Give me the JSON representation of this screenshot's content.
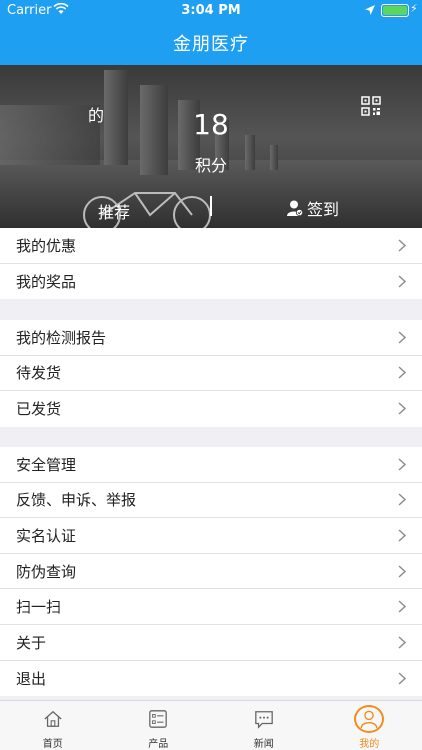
{
  "status": {
    "carrier": "Carrier",
    "time": "3:04 PM"
  },
  "nav": {
    "title": "金朋医疗"
  },
  "profile": {
    "nickname": "的",
    "points": "18",
    "points_label": "积分",
    "recommend_label": "推荐",
    "checkin_label": "签到"
  },
  "groups": [
    {
      "items": [
        {
          "label": "我的优惠"
        },
        {
          "label": "我的奖品"
        }
      ]
    },
    {
      "items": [
        {
          "label": "我的检测报告"
        },
        {
          "label": "待发货"
        },
        {
          "label": "已发货"
        }
      ]
    },
    {
      "items": [
        {
          "label": "安全管理"
        },
        {
          "label": "反馈、申诉、举报"
        },
        {
          "label": "实名认证"
        },
        {
          "label": "防伪查询"
        },
        {
          "label": "扫一扫"
        },
        {
          "label": "关于"
        },
        {
          "label": "退出"
        }
      ]
    }
  ],
  "tabs": [
    {
      "label": "首页",
      "icon": "home-icon"
    },
    {
      "label": "产品",
      "icon": "product-list-icon"
    },
    {
      "label": "新闻",
      "icon": "news-chat-icon"
    },
    {
      "label": "我的",
      "icon": "profile-icon",
      "active": true
    }
  ],
  "colors": {
    "nav_blue": "#1e9ff2",
    "active_orange": "#f28c1e"
  }
}
